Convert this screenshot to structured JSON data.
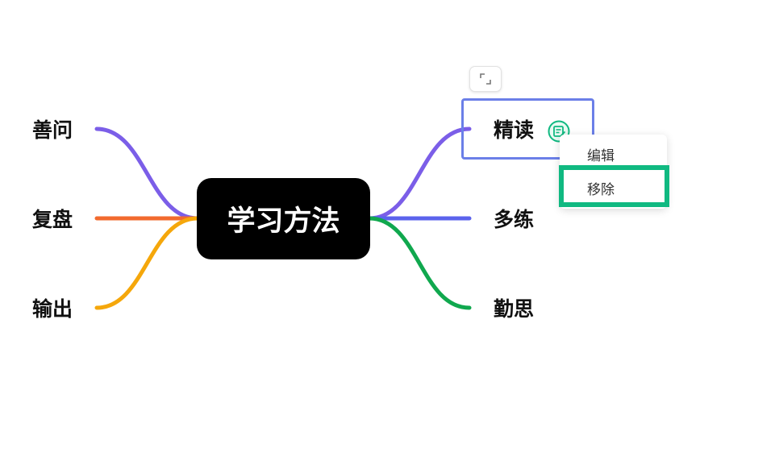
{
  "mindmap": {
    "root": {
      "label": "学习方法"
    },
    "left_branches": [
      {
        "label": "善问",
        "color": "#7b5ee8"
      },
      {
        "label": "复盘",
        "color": "#f26a2e"
      },
      {
        "label": "输出",
        "color": "#f5a70b"
      }
    ],
    "right_branches": [
      {
        "label": "精读",
        "color": "#7b5ee8",
        "selected": true,
        "has_note": true
      },
      {
        "label": "多练",
        "color": "#5b63ec"
      },
      {
        "label": "勤思",
        "color": "#10a84e"
      }
    ],
    "selection_color": "#6b7fe8"
  },
  "context_menu": {
    "items": [
      {
        "label": "编辑"
      },
      {
        "label": "移除"
      }
    ],
    "highlight_color": "#10b981"
  },
  "icons": {
    "note": "note-icon",
    "collapse": "collapse-toggle-icon"
  }
}
